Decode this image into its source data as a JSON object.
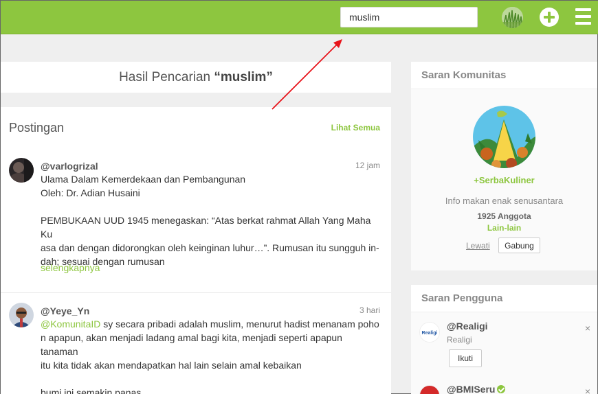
{
  "search": {
    "value": "muslim"
  },
  "results": {
    "prefix": "Hasil Pencarian ",
    "query": "“muslim”"
  },
  "posts": {
    "title": "Postingan",
    "see_all": "Lihat Semua",
    "items": [
      {
        "username": "@varlogrizal",
        "time": "12 jam",
        "body": "Ulama Dalam Kemerdekaan dan Pembangunan\nOleh: Dr. Adian Husaini\n\nPEMBUKAAN UUD 1945 menegaskan: “Atas berkat rahmat Allah Yang Maha Ku\nasa dan dengan didorongkan oleh keinginan luhur…”.  Rumusan itu sungguh in-\ndah; sesuai dengan rumusan",
        "read_more": "selengkapnya"
      },
      {
        "username": "@Yeye_Yn",
        "time": "3 hari",
        "mention": "@KomunitaID",
        "body": " sy secara pribadi adalah muslim, menurut hadist menanam poho\nn apapun, akan menjadi ladang amal bagi kita, menjadi seperti apapun tanaman\n itu kita tidak akan mendapatkan hal lain selain amal kebaikan\n\nbumi ini semakin panas,"
      }
    ]
  },
  "community": {
    "title": "Saran Komunitas",
    "name": "+SerbaKuliner",
    "desc": "Info makan enak senusantara",
    "count": "1925 Anggota",
    "category": "Lain-lain",
    "skip": "Lewati",
    "join": "Gabung"
  },
  "users": {
    "title": "Saran Pengguna",
    "items": [
      {
        "name": "@Realigi",
        "sub": "Realigi",
        "logo_text": "Realigi",
        "follow": "Ikuti",
        "close": "×"
      },
      {
        "name": "@BMISeru",
        "close": "×"
      }
    ]
  },
  "colors": {
    "brand": "#8dc63f",
    "annotation": "#e8141b"
  }
}
